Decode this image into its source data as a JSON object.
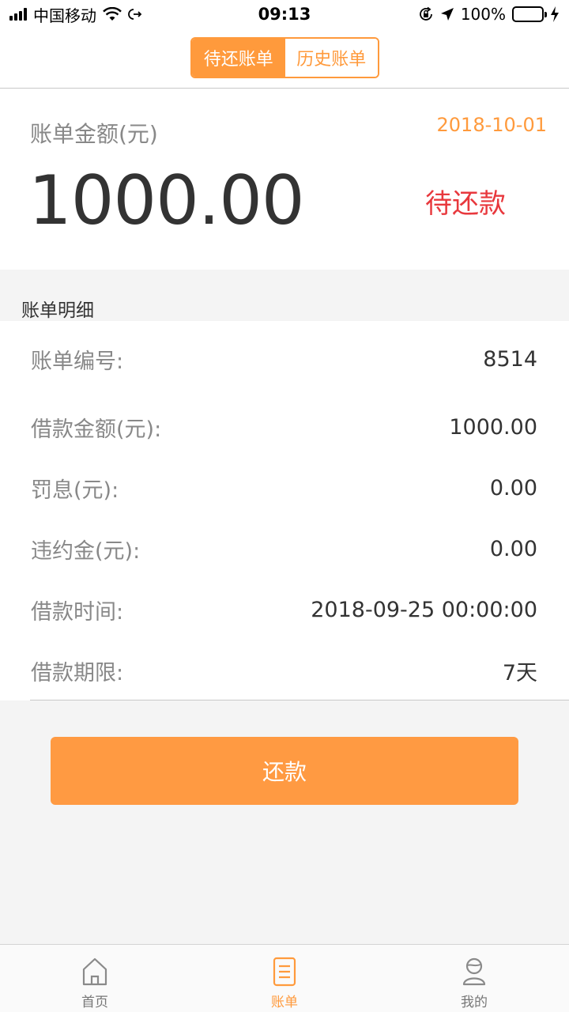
{
  "status_bar": {
    "carrier": "中国移动",
    "time": "09:13",
    "battery": "100%"
  },
  "header": {
    "tabs": [
      {
        "label": "待还账单",
        "active": true
      },
      {
        "label": "历史账单",
        "active": false
      }
    ]
  },
  "summary": {
    "label": "账单金额(元)",
    "date": "2018-10-01",
    "amount": "1000.00",
    "status": "待还款"
  },
  "details": {
    "heading": "账单明细",
    "rows": [
      {
        "key": "账单编号:",
        "value": "8514"
      },
      {
        "key": "借款金额(元):",
        "value": "1000.00"
      },
      {
        "key": "罚息(元):",
        "value": "0.00"
      },
      {
        "key": "违约金(元):",
        "value": "0.00"
      },
      {
        "key": "借款时间:",
        "value": "2018-09-25 00:00:00"
      },
      {
        "key": "借款期限:",
        "value": "7天"
      }
    ]
  },
  "repay_button": {
    "label": "还款"
  },
  "tab_bar": {
    "items": [
      {
        "label": "首页",
        "icon": "home-icon",
        "active": false
      },
      {
        "label": "账单",
        "icon": "bill-icon",
        "active": true
      },
      {
        "label": "我的",
        "icon": "profile-icon",
        "active": false
      }
    ]
  },
  "colors": {
    "accent": "#ff9a3c",
    "status_red": "#e8383d",
    "battery_green": "#4cd964"
  }
}
